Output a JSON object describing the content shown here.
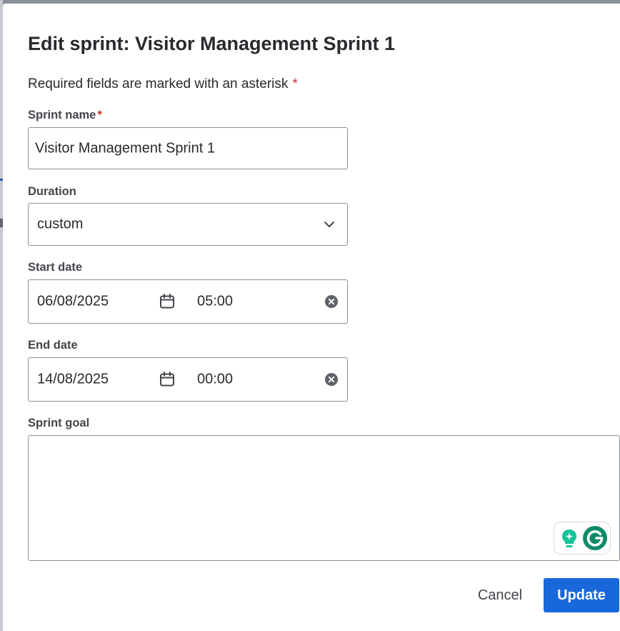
{
  "dialog": {
    "title": "Edit sprint: Visitor Management Sprint 1",
    "required_note": "Required fields are marked with an asterisk",
    "required_marker": "*"
  },
  "sprint_name": {
    "label": "Sprint name",
    "value": "Visitor Management Sprint 1"
  },
  "duration": {
    "label": "Duration",
    "value": "custom",
    "icon": "chevron-down-icon"
  },
  "start": {
    "label": "Start date",
    "date": "06/08/2025",
    "time": "05:00",
    "calendar_icon": "calendar-icon",
    "clear_icon": "clear-icon"
  },
  "end": {
    "label": "End date",
    "date": "14/08/2025",
    "time": "00:00",
    "calendar_icon": "calendar-icon",
    "clear_icon": "clear-icon"
  },
  "goal": {
    "label": "Sprint goal",
    "value": ""
  },
  "grammarly": {
    "icons": [
      "lightbulb-icon",
      "grammarly-g-icon"
    ],
    "colors": {
      "bulb": "#15c39a",
      "g": "#0d8a6a"
    }
  },
  "actions": {
    "cancel_label": "Cancel",
    "update_label": "Update"
  },
  "colors": {
    "primary": "#1868db",
    "asterisk": "#c9372c",
    "text": "#292a2e"
  }
}
